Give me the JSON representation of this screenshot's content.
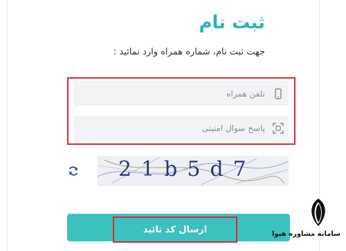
{
  "form": {
    "title": "ثبت نام",
    "subtitle": "جهت ثبت نام، شماره همراه وارد نمائید :",
    "phone_placeholder": "تلفن همراه",
    "security_placeholder": "پاسخ سوال امنیتی",
    "captcha_text": "21b5d7",
    "submit_label": "ارسال کد تائید"
  },
  "icons": {
    "phone": "mobile-phone-icon",
    "security": "qr-scan-icon",
    "refresh": "refresh-icon"
  },
  "colors": {
    "accent": "#2bb4b4",
    "button": "#3cc1c1",
    "highlight": "#d92b2b",
    "field_bg": "#f2f3f5"
  },
  "watermark": {
    "text": "سامانه مشاوره هیوا"
  }
}
